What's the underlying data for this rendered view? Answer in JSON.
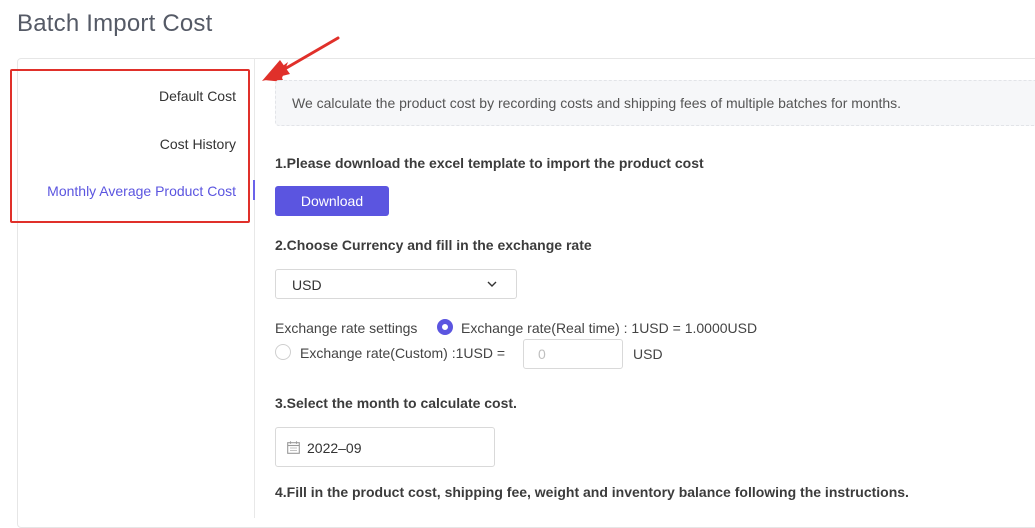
{
  "page": {
    "title": "Batch Import Cost"
  },
  "sidebar": {
    "items": [
      {
        "label": "Default Cost",
        "active": false
      },
      {
        "label": "Cost History",
        "active": false
      },
      {
        "label": "Monthly Average Product Cost",
        "active": true
      }
    ]
  },
  "main": {
    "info": "We calculate the product cost by recording costs and shipping fees of multiple batches for months.",
    "step1": {
      "heading": "1.Please download the excel template to import the product cost",
      "button": "Download"
    },
    "step2": {
      "heading": "2.Choose Currency and fill in the exchange rate",
      "currency": "USD",
      "settings_label": "Exchange rate settings",
      "realtime_label": "Exchange rate(Real time) : 1USD = 1.0000USD",
      "custom_label": "Exchange rate(Custom) :1USD =",
      "custom_value": "",
      "custom_placeholder": "0",
      "custom_unit": "USD",
      "selected": "realtime"
    },
    "step3": {
      "heading": "3.Select the month to calculate cost.",
      "month": "2022–09"
    },
    "step4": {
      "heading": "4.Fill in the product cost, shipping fee, weight and inventory balance following the instructions."
    }
  },
  "colors": {
    "accent": "#5b55e0",
    "annotation": "#e0302a"
  },
  "icons": {
    "dropdown": "chevron-down-icon",
    "calendar": "calendar-icon",
    "annotation": "arrow-annotation-icon"
  }
}
